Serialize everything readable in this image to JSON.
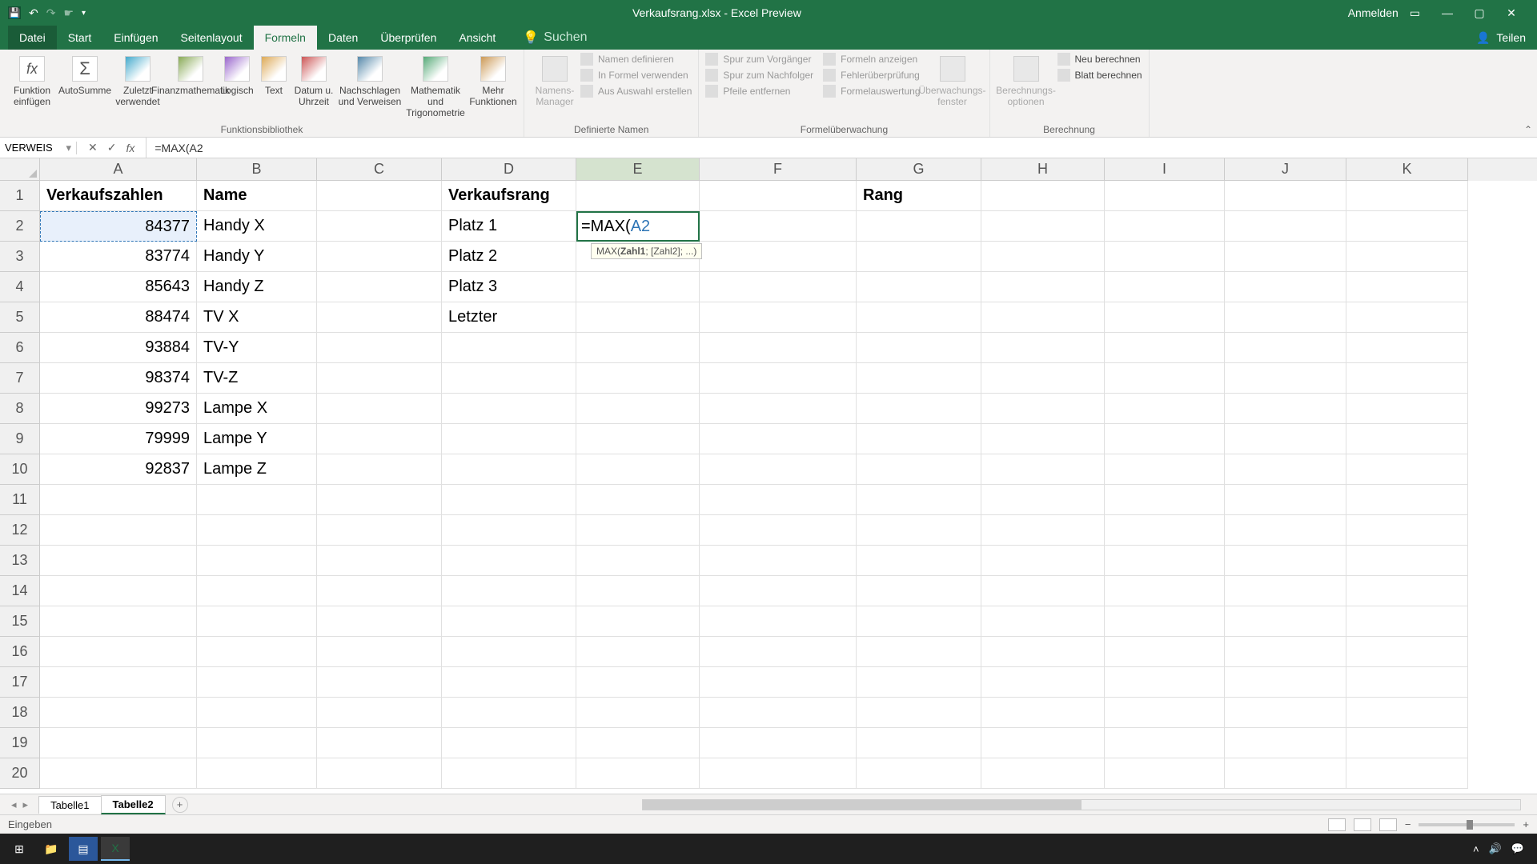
{
  "title_bar": {
    "title": "Verkaufsrang.xlsx - Excel Preview",
    "signin": "Anmelden"
  },
  "menu": {
    "file": "Datei",
    "start": "Start",
    "einfugen": "Einfügen",
    "seitenlayout": "Seitenlayout",
    "formeln": "Formeln",
    "daten": "Daten",
    "uberprufen": "Überprüfen",
    "ansicht": "Ansicht",
    "suchen": "Suchen",
    "teilen": "Teilen"
  },
  "ribbon": {
    "funktion": "Funktion einfügen",
    "autosumme": "AutoSumme",
    "zuletzt": "Zuletzt verwendet",
    "finanz": "Finanzmathematik",
    "logisch": "Logisch",
    "text": "Text",
    "datum": "Datum u. Uhrzeit",
    "nachschlagen": "Nachschlagen und Verweisen",
    "mathematik": "Mathematik und Trigonometrie",
    "mehr": "Mehr Funktionen",
    "bibliothek": "Funktionsbibliothek",
    "namens": "Namens-Manager",
    "def1": "Namen definieren",
    "def2": "In Formel verwenden",
    "def3": "Aus Auswahl erstellen",
    "definierte": "Definierte Namen",
    "spur1": "Spur zum Vorgänger",
    "spur2": "Spur zum Nachfolger",
    "spur3": "Pfeile entfernen",
    "fehler1": "Formeln anzeigen",
    "fehler2": "Fehlerüberprüfung",
    "fehler3": "Formelauswertung",
    "formeluber": "Formelüberwachung",
    "uberwach": "Überwachungs-fenster",
    "berechopt": "Berechnungs-optionen",
    "neu": "Neu berechnen",
    "blatt": "Blatt berechnen",
    "berechnung": "Berechnung"
  },
  "formula_bar": {
    "name_box": "VERWEIS",
    "formula": "=MAX(A2"
  },
  "columns": [
    "A",
    "B",
    "C",
    "D",
    "E",
    "F",
    "G",
    "H",
    "I",
    "J",
    "K"
  ],
  "col_widths": [
    "col-A",
    "col-B",
    "col-C",
    "col-D",
    "col-E",
    "col-F",
    "col-G",
    "col-H",
    "col-I",
    "col-J",
    "col-K"
  ],
  "sheet": {
    "headers": {
      "A1": "Verkaufszahlen",
      "B1": "Name",
      "D1": "Verkaufsrang",
      "G1": "Rang"
    },
    "rows": [
      {
        "A": "84377",
        "B": "Handy X",
        "D": "Platz 1"
      },
      {
        "A": "83774",
        "B": "Handy Y",
        "D": "Platz 2"
      },
      {
        "A": "85643",
        "B": "Handy Z",
        "D": "Platz 3"
      },
      {
        "A": "88474",
        "B": "TV X",
        "D": "Letzter"
      },
      {
        "A": "93884",
        "B": "TV-Y",
        "D": ""
      },
      {
        "A": "98374",
        "B": "TV-Z",
        "D": ""
      },
      {
        "A": "99273",
        "B": "Lampe X",
        "D": ""
      },
      {
        "A": "79999",
        "B": "Lampe Y",
        "D": ""
      },
      {
        "A": "92837",
        "B": "Lampe Z",
        "D": ""
      }
    ],
    "editing": {
      "text_prefix": "=MAX(",
      "text_ref": "A2",
      "tooltip_func": "MAX(",
      "tooltip_bold": "Zahl1",
      "tooltip_rest": "; [Zahl2]; ...)"
    }
  },
  "sheet_tabs": {
    "t1": "Tabelle1",
    "t2": "Tabelle2"
  },
  "status": {
    "mode": "Eingeben"
  }
}
